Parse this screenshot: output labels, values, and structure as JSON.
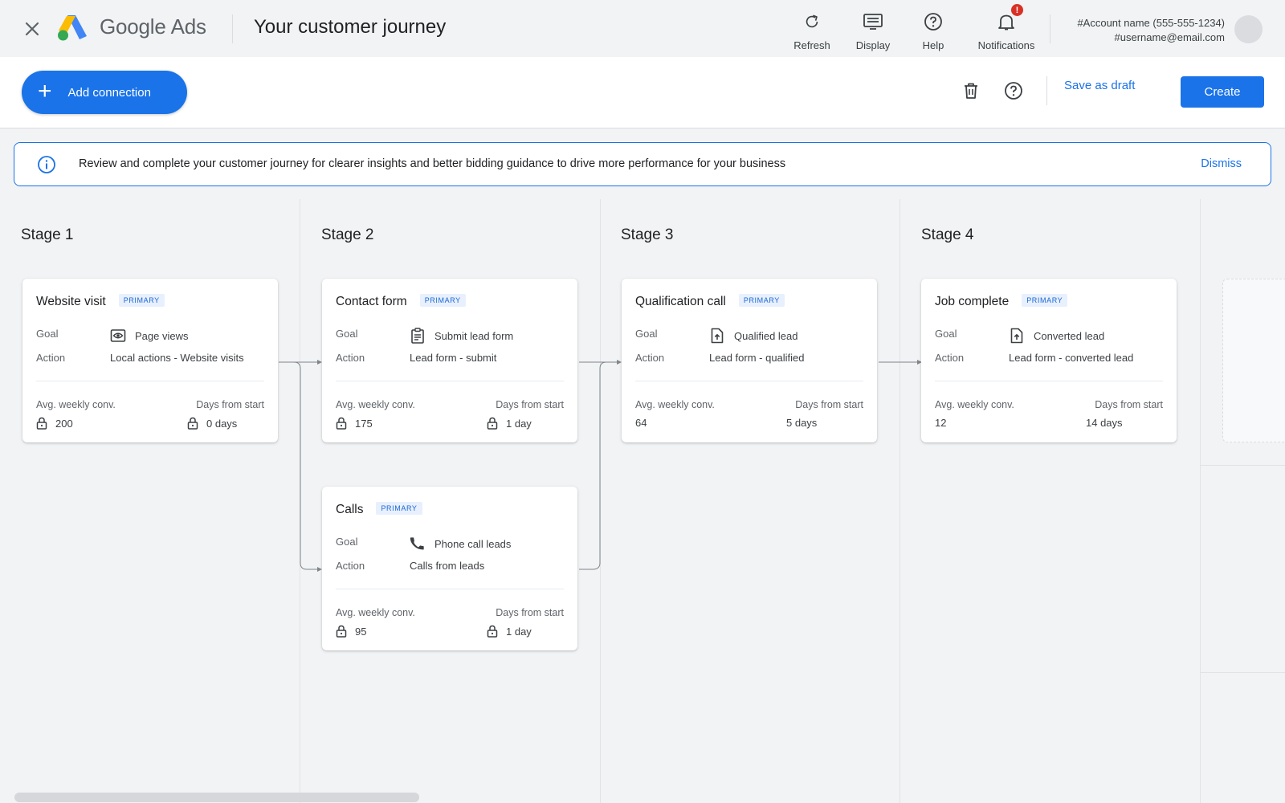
{
  "app": {
    "brand_google": "Google",
    "brand_ads": "Ads",
    "page_title": "Your customer journey"
  },
  "header_tools": [
    {
      "label": "Refresh",
      "icon": "refresh-icon"
    },
    {
      "label": "Display",
      "icon": "display-icon"
    },
    {
      "label": "Help",
      "icon": "help-icon"
    },
    {
      "label": "Notifications",
      "icon": "bell-icon",
      "badge": "!"
    }
  ],
  "account": {
    "name": "#Account name (555-555-1234)",
    "email": "#username@email.com"
  },
  "toolbar": {
    "add_connection": "Add connection",
    "save_draft": "Save as draft",
    "create": "Create"
  },
  "banner": {
    "message": "Review and complete your customer journey for clearer insights and better bidding guidance to drive more performance for your business",
    "dismiss": "Dismiss"
  },
  "labels": {
    "goal": "Goal",
    "action": "Action",
    "avg_weekly": "Avg. weekly conv.",
    "days_from_start": "Days from start",
    "primary": "PRIMARY"
  },
  "stages": [
    {
      "title": "Stage 1"
    },
    {
      "title": "Stage 2"
    },
    {
      "title": "Stage 3"
    },
    {
      "title": "Stage 4"
    }
  ],
  "cards": [
    {
      "name": "Website visit",
      "goal": "Page views",
      "goal_icon": "eye-icon",
      "action": "Local actions - Website visits",
      "avg": "200",
      "days": "0 days",
      "locked": true
    },
    {
      "name": "Contact form",
      "goal": "Submit lead form",
      "goal_icon": "form-icon",
      "action": "Lead form - submit",
      "avg": "175",
      "days": "1 day",
      "locked": true
    },
    {
      "name": "Calls",
      "goal": "Phone call leads",
      "goal_icon": "phone-icon",
      "action": "Calls from leads",
      "avg": "95",
      "days": "1 day",
      "locked": true
    },
    {
      "name": "Qualification call",
      "goal": "Qualified lead",
      "goal_icon": "document-upload-icon",
      "action": "Lead form - qualified",
      "avg": "64",
      "days": "5 days",
      "locked": false
    },
    {
      "name": "Job complete",
      "goal": "Converted lead",
      "goal_icon": "document-upload-icon",
      "action": "Lead form - converted lead",
      "avg": "12",
      "days": "14 days",
      "locked": false
    }
  ],
  "colors": {
    "primary": "#1a73e8",
    "badge": "#d93025",
    "chip_bg": "#e8f0fe",
    "chip_text": "#1967d2"
  }
}
